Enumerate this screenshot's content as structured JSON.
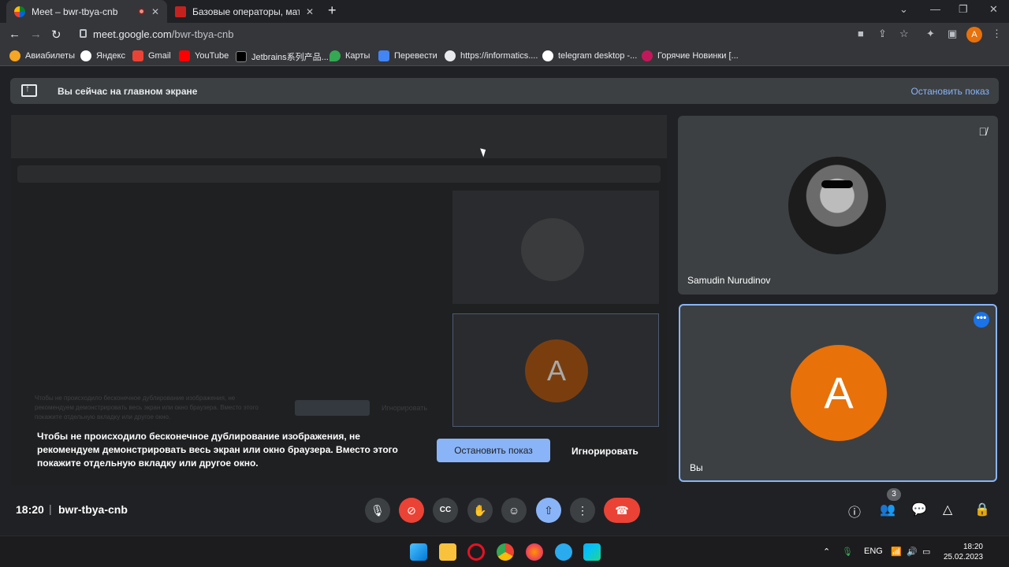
{
  "browser": {
    "tabs": [
      {
        "title": "Meet – bwr-tbya-cnb",
        "active": true
      },
      {
        "title": "Базовые операторы, математи",
        "active": false
      }
    ],
    "url_host": "meet.google.com",
    "url_path": "/bwr-tbya-cnb",
    "profile_initial": "A",
    "bookmarks": [
      "Авиабилеты",
      "Яндекс",
      "Gmail",
      "YouTube",
      "Jetbrains系列产品...",
      "Карты",
      "Перевести",
      "https://informatics....",
      "telegram desktop -...",
      "Горячие Новинки [..."
    ]
  },
  "banner": {
    "text": "Вы сейчас на главном экране",
    "stop_label": "Остановить показ"
  },
  "notice": {
    "text": "Чтобы не происходило бесконечное дублирование изображения, не рекомендуем демонстрировать весь экран или окно браузера. Вместо этого покажите отдельную вкладку или другое окно.",
    "stop_label": "Остановить показ",
    "ignore_label": "Игнорировать"
  },
  "participants": [
    {
      "name": "Samudin Nurudinov",
      "muted": true
    },
    {
      "name": "Вы",
      "initial": "A"
    }
  ],
  "meeting": {
    "time": "18:20",
    "separator": "|",
    "code": "bwr-tbya-cnb",
    "participant_count": "3"
  },
  "taskbar": {
    "language": "ENG",
    "time": "18:20",
    "date": "25.02.2023"
  },
  "colors": {
    "accent": "#8ab4f8",
    "danger": "#ea4335",
    "avatar": "#e8710a"
  }
}
